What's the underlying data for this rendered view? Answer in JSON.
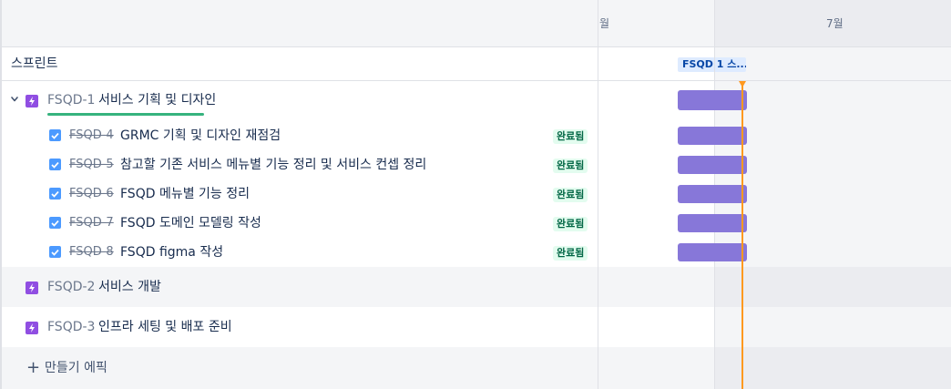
{
  "timeline": {
    "month_june_partial": "월",
    "month_july": "7월"
  },
  "sprint_row": {
    "label": "스프린트",
    "chip": "FSQD 1 스..."
  },
  "epics": [
    {
      "key": "FSQD-1",
      "title": "서비스 기획 및 디자인",
      "expanded": true,
      "icon": "lightning-icon",
      "children": [
        {
          "key": "FSQD-4",
          "title": "GRMC 기획 및 디자인 재점검",
          "status": "완료됨",
          "checked": true
        },
        {
          "key": "FSQD-5",
          "title": "참고할 기존 서비스 메뉴별 기능 정리 및 서비스 컨셉 정리",
          "status": "완료됨",
          "checked": true
        },
        {
          "key": "FSQD-6",
          "title": "FSQD 메뉴별 기능 정리",
          "status": "완료됨",
          "checked": true
        },
        {
          "key": "FSQD-7",
          "title": "FSQD 도메인 모델링 작성",
          "status": "완료됨",
          "checked": true
        },
        {
          "key": "FSQD-8",
          "title": "FSQD figma 작성",
          "status": "완료됨",
          "checked": true
        }
      ]
    },
    {
      "key": "FSQD-2",
      "title": "서비스 개발",
      "icon": "lightning-icon"
    },
    {
      "key": "FSQD-3",
      "title": "인프라 세팅 및 배포 준비",
      "icon": "lightning-icon"
    }
  ],
  "create_epic": {
    "label": "만들기 에픽",
    "icon": "plus-icon"
  },
  "colors": {
    "epic_icon": "#904ee2",
    "bar": "#8777d9",
    "today_marker": "#ff991f",
    "done_lozenge_bg": "#e3fcef",
    "done_lozenge_text": "#006644",
    "checkbox": "#4c9aff",
    "progress_underline": "#36b37e"
  }
}
